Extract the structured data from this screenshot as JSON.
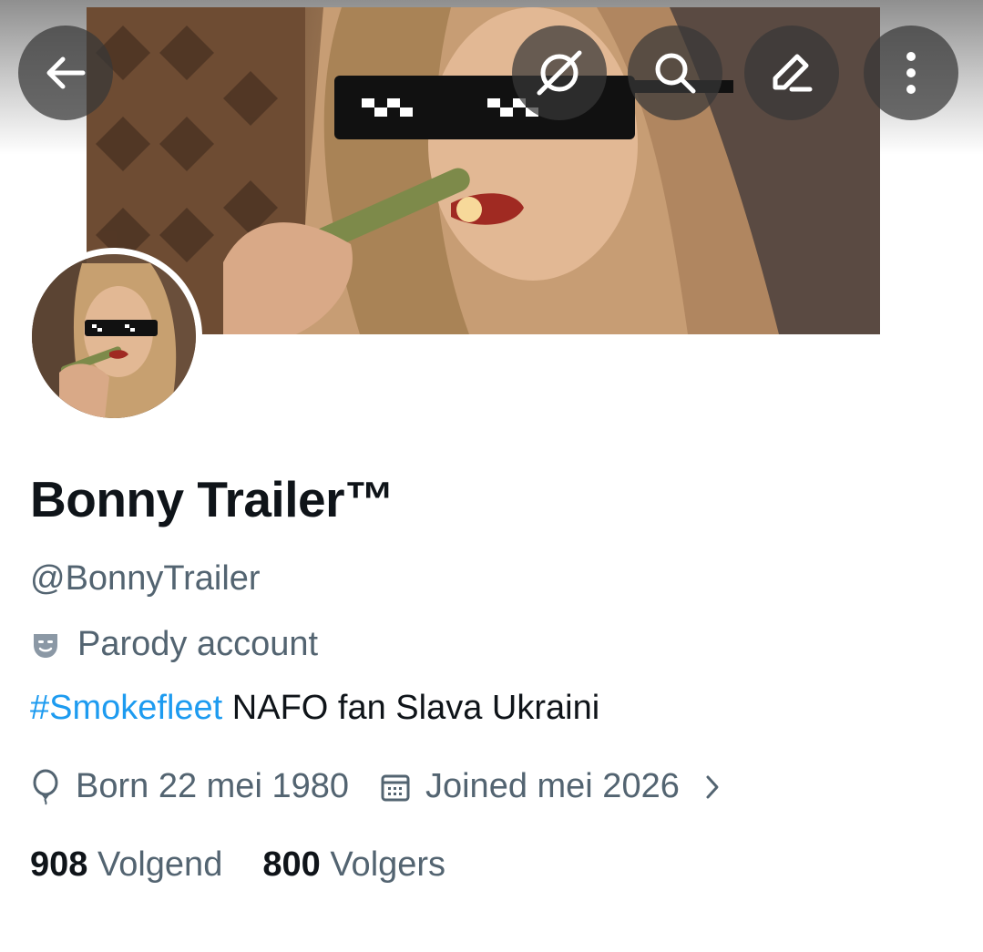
{
  "header": {
    "back_icon": "arrow-left-icon",
    "grok_icon": "grok-icon",
    "search_icon": "search-icon",
    "compose_icon": "pencil-icon",
    "more_icon": "more-vertical-icon"
  },
  "profile": {
    "display_name": "Bonny Trailer™",
    "handle": "@BonnyTrailer",
    "label_icon": "theater-mask-icon",
    "label": "Parody account",
    "bio_hashtag": "#Smokefleet",
    "bio_text": " NAFO fan Slava Ukraini",
    "born_icon": "balloon-icon",
    "born": "Born 22 mei 1980",
    "joined_icon": "calendar-icon",
    "joined": "Joined mei 2026",
    "chevron_icon": "chevron-right-icon"
  },
  "stats": {
    "following_count": "908",
    "following_label": "Volgend",
    "followers_count": "800",
    "followers_label": "Volgers"
  },
  "colors": {
    "link": "#1d9bf0",
    "secondary_text": "#536471",
    "primary_text": "#0f1419"
  }
}
